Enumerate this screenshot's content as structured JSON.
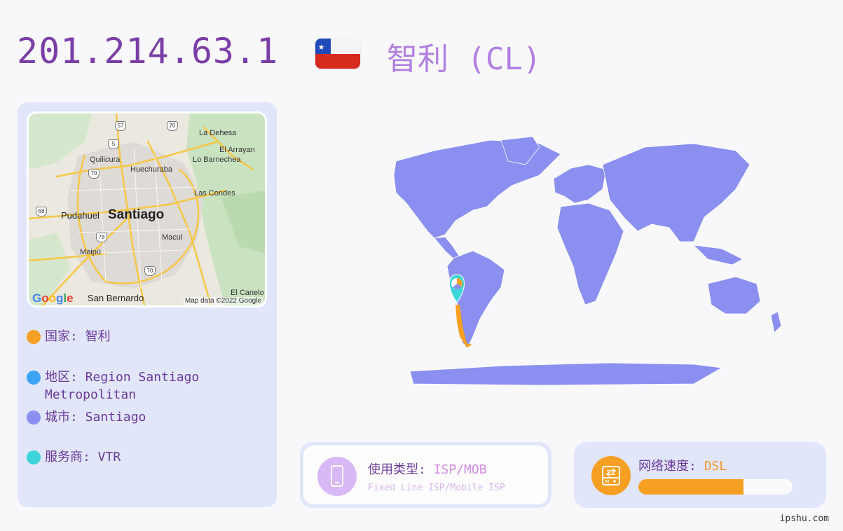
{
  "header": {
    "ip": "201.214.63.1",
    "country_title": "智利 (CL)",
    "flag": "chile-flag"
  },
  "map": {
    "labels": {
      "la_dehesa": "La Dehesa",
      "el_arrayan": "El Arrayan",
      "lo_barnechea": "Lo Barnechea",
      "quilicura": "Quilicura",
      "huechuraba": "Huechuraba",
      "las_condes": "Las Condes",
      "pudahuel": "Pudahuel",
      "santiago": "Santiago",
      "macul": "Macul",
      "maipu": "Maipú",
      "san_bernardo": "San Bernardo",
      "el_canelo": "El Canelo"
    },
    "shields": {
      "r57": "57",
      "r5": "5",
      "r70a": "70",
      "r68": "68",
      "r78": "78",
      "r70b": "70",
      "r70c": "70"
    },
    "google": "Google",
    "attribution": "Map data ©2022 Google"
  },
  "info": {
    "country": "国家: 智利",
    "region": "地区: Region Santiago Metropolitan",
    "city": "城市: Santiago",
    "isp": "服务商: VTR",
    "colors": {
      "country": "#f5a023",
      "region": "#3fa3f5",
      "city": "#8a8ff0",
      "isp": "#3dd5da"
    }
  },
  "usage": {
    "label": "使用类型: ",
    "value": "ISP/MOB",
    "subtitle": "Fixed Line ISP/Mobile ISP",
    "icon": "mobile-phone-icon"
  },
  "speed": {
    "label": "网络速度: ",
    "value": "DSL",
    "level": 0.68,
    "icon": "network-drive-icon"
  },
  "footer": {
    "site": "ipshu.com"
  }
}
